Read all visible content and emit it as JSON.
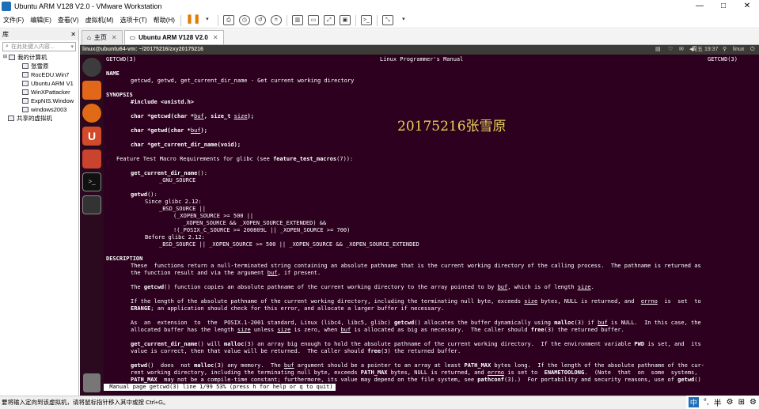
{
  "window": {
    "title": "Ubuntu ARM V128 V2.0 - VMware Workstation",
    "min": "—",
    "max": "□",
    "close": "✕"
  },
  "menu": [
    "文件(F)",
    "编辑(E)",
    "查看(V)",
    "虚拟机(M)",
    "选项卡(T)",
    "帮助(H)"
  ],
  "sidebar": {
    "title": "库",
    "close": "✕",
    "search_placeholder": "在此处键入内容...",
    "items": [
      {
        "label": "我的计算机",
        "level": 0
      },
      {
        "label": "张雪原",
        "level": 1
      },
      {
        "label": "RocEDU.Win7",
        "level": 1
      },
      {
        "label": "Ubuntu ARM V1",
        "level": 1
      },
      {
        "label": "WinXPattacker",
        "level": 1
      },
      {
        "label": "ExpNIS.Window",
        "level": 1
      },
      {
        "label": "windows2003",
        "level": 1
      },
      {
        "label": "共享的虚拟机",
        "level": 0
      }
    ]
  },
  "tabs": [
    {
      "label": "主页",
      "active": false
    },
    {
      "label": "Ubuntu ARM V128 V2.0",
      "active": true
    }
  ],
  "ubuntu_bar": {
    "path": "linux@ubuntu64-vm: ~/20175216/zxy20175216",
    "clock": "周五 19:37",
    "user": "linux"
  },
  "terminal": {
    "header_left": "GETCWD(3)",
    "header_center": "Linux Programmer's Manual",
    "header_right": "GETCWD(3)",
    "watermark": "20175216张雪原",
    "status_line": " Manual page getcwd(3) line 1/99 53% (press h for help or q to quit)"
  },
  "statusbar": {
    "text": "要将输入定向到该虚拟机，请将鼠标指针移入其中或按 Ctrl+G。"
  },
  "tray": {
    "ime": "中",
    "items": [
      "°,",
      "半",
      "⚙",
      "⊞",
      "⚙"
    ]
  }
}
